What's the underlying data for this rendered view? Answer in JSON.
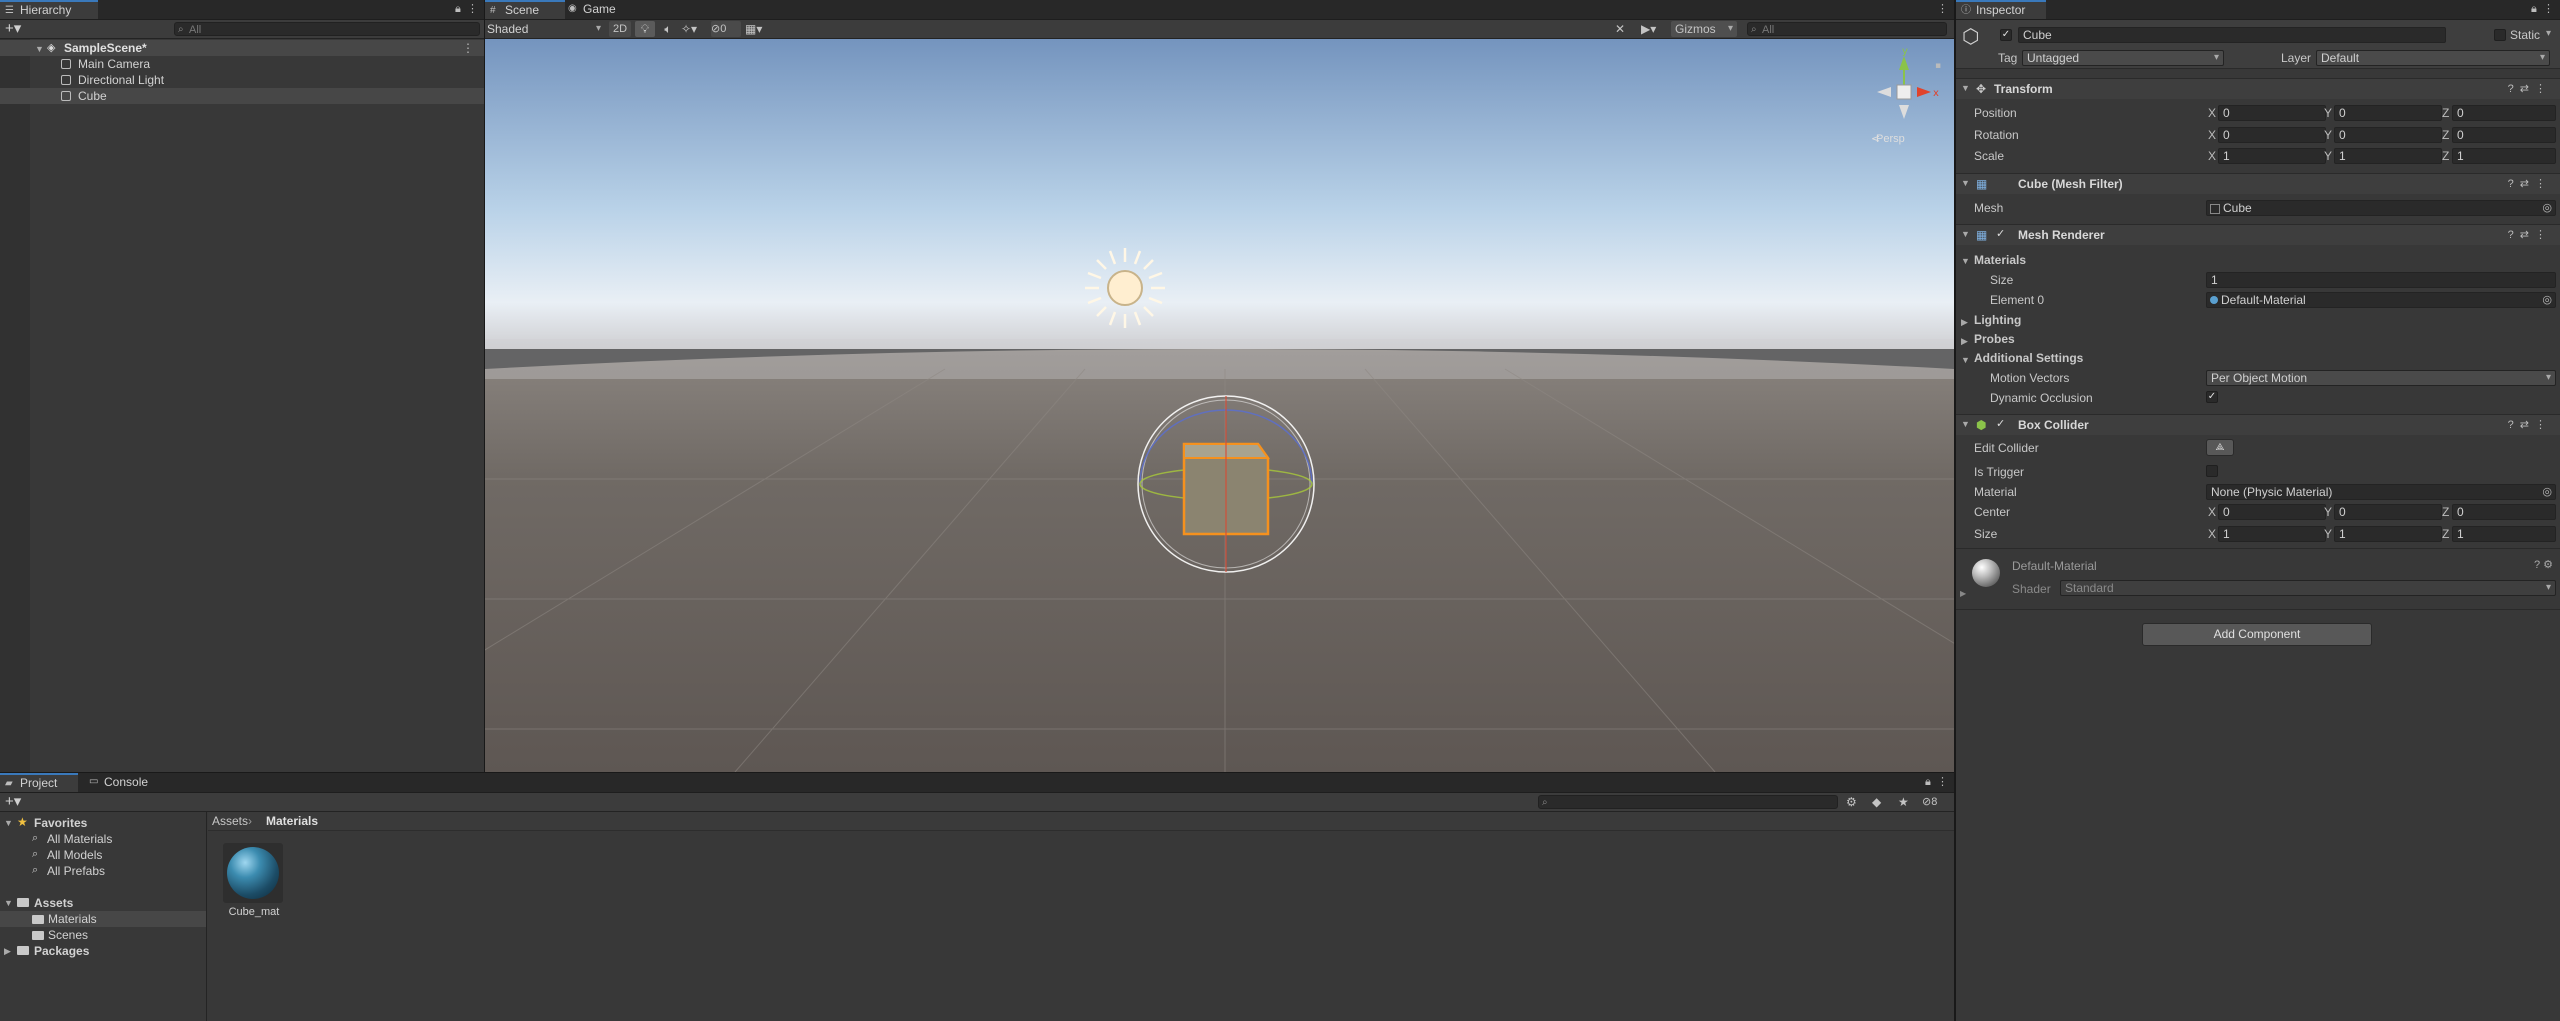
{
  "hierarchy": {
    "tab": "Hierarchy",
    "search_placeholder": "All",
    "scene": "SampleScene*",
    "items": [
      "Main Camera",
      "Directional Light",
      "Cube"
    ]
  },
  "scene_view": {
    "tabs": [
      "Scene",
      "Game"
    ],
    "shading_mode": "Shaded",
    "toggle_2d": "2D",
    "hidden_count": "0",
    "gizmos": "Gizmos",
    "search_placeholder": "All",
    "persp_label": "Persp",
    "axis_x": "x",
    "axis_y": "y"
  },
  "project": {
    "tabs": [
      "Project",
      "Console"
    ],
    "favorites_label": "Favorites",
    "favorites": [
      "All Materials",
      "All Models",
      "All Prefabs"
    ],
    "assets_label": "Assets",
    "asset_folders": [
      "Materials",
      "Scenes"
    ],
    "packages_label": "Packages",
    "breadcrumb": [
      "Assets",
      "Materials"
    ],
    "files": [
      {
        "name": "Cube_mat"
      }
    ],
    "hidden_count": "8"
  },
  "inspector": {
    "tab": "Inspector",
    "object_name": "Cube",
    "static_label": "Static",
    "tag_label": "Tag",
    "tag": "Untagged",
    "layer_label": "Layer",
    "layer": "Default",
    "transform": {
      "title": "Transform",
      "position_label": "Position",
      "position": [
        "0",
        "0",
        "0"
      ],
      "rotation_label": "Rotation",
      "rotation": [
        "0",
        "0",
        "0"
      ],
      "scale_label": "Scale",
      "scale": [
        "1",
        "1",
        "1"
      ]
    },
    "mesh_filter": {
      "title": "Cube (Mesh Filter)",
      "mesh_label": "Mesh",
      "mesh": "Cube"
    },
    "mesh_renderer": {
      "title": "Mesh Renderer",
      "materials_label": "Materials",
      "size_label": "Size",
      "size": "1",
      "element0_label": "Element 0",
      "element0": "Default-Material",
      "lighting_label": "Lighting",
      "probes_label": "Probes",
      "additional_label": "Additional Settings",
      "motion_vectors_label": "Motion Vectors",
      "motion_vectors": "Per Object Motion",
      "dynamic_occlusion_label": "Dynamic Occlusion"
    },
    "box_collider": {
      "title": "Box Collider",
      "edit_collider_label": "Edit Collider",
      "is_trigger_label": "Is Trigger",
      "material_label": "Material",
      "material": "None (Physic Material)",
      "center_label": "Center",
      "center": [
        "0",
        "0",
        "0"
      ],
      "size_label": "Size",
      "size": [
        "1",
        "1",
        "1"
      ]
    },
    "material": {
      "name": "Default-Material",
      "shader_label": "Shader",
      "shader": "Standard"
    },
    "add_component": "Add Component"
  },
  "axis_labels": [
    "X",
    "Y",
    "Z"
  ]
}
